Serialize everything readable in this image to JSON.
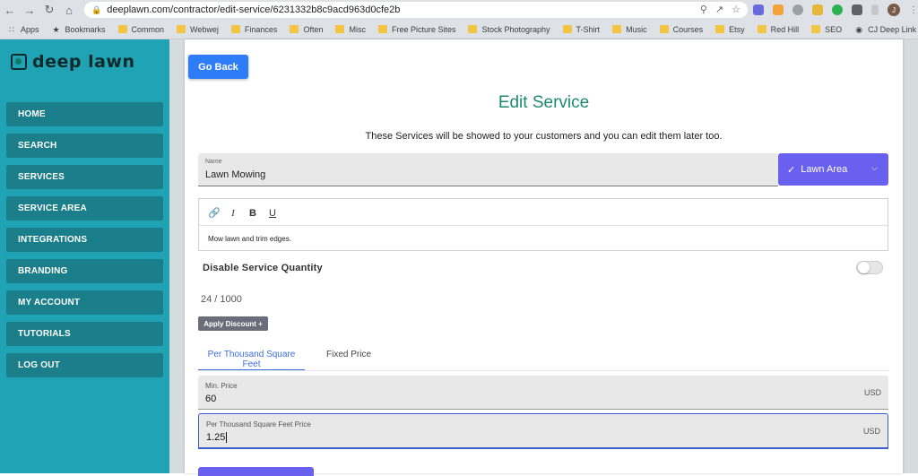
{
  "browser": {
    "url": "deeplawn.com/contractor/edit-service/6231332b8c9acd963d0cfe2b",
    "profile_initial": "J",
    "bookmarks": [
      "Apps",
      "Bookmarks",
      "Common",
      "Webwej",
      "Finances",
      "Often",
      "Misc",
      "Free Picture Sites",
      "Stock Photography",
      "T-Shirt",
      "Music",
      "Courses",
      "Etsy",
      "Red Hill",
      "SEO",
      "CJ Deep Link"
    ]
  },
  "sidebar": {
    "logo": "deep lawn",
    "items": [
      "HOME",
      "SEARCH",
      "SERVICES",
      "SERVICE AREA",
      "INTEGRATIONS",
      "BRANDING",
      "MY ACCOUNT",
      "TUTORIALS",
      "LOG OUT"
    ]
  },
  "main": {
    "go_back": "Go Back",
    "title": "Edit Service",
    "subtitle": "These Services will be showed to your customers and you can edit them later too.",
    "name_label": "Name",
    "name_value": "Lawn Mowing",
    "lawn_area_button": "Lawn Area",
    "editor_toolbar": [
      "link",
      "I",
      "B",
      "U"
    ],
    "editor_text": "Mow lawn and trim edges.",
    "disable_quantity_label": "Disable Service Quantity",
    "disable_quantity_on": false,
    "char_counter": "24 / 1000",
    "apply_discount": "Apply Discount +",
    "tabs": [
      "Per Thousand Square Feet",
      "Fixed Price"
    ],
    "min_price_label": "Min. Price",
    "min_price_value": "60",
    "min_price_unit": "USD",
    "ptsf_label": "Per Thousand Square Feet Price",
    "ptsf_value": "1.25",
    "ptsf_unit": "USD"
  },
  "colors": {
    "sidebar_bg": "#1fa3b5",
    "sidebar_item": "#1a7f8b",
    "accent_blue": "#2e7cf6",
    "accent_purple": "#6a60ef",
    "title_green": "#1d8a6e"
  }
}
